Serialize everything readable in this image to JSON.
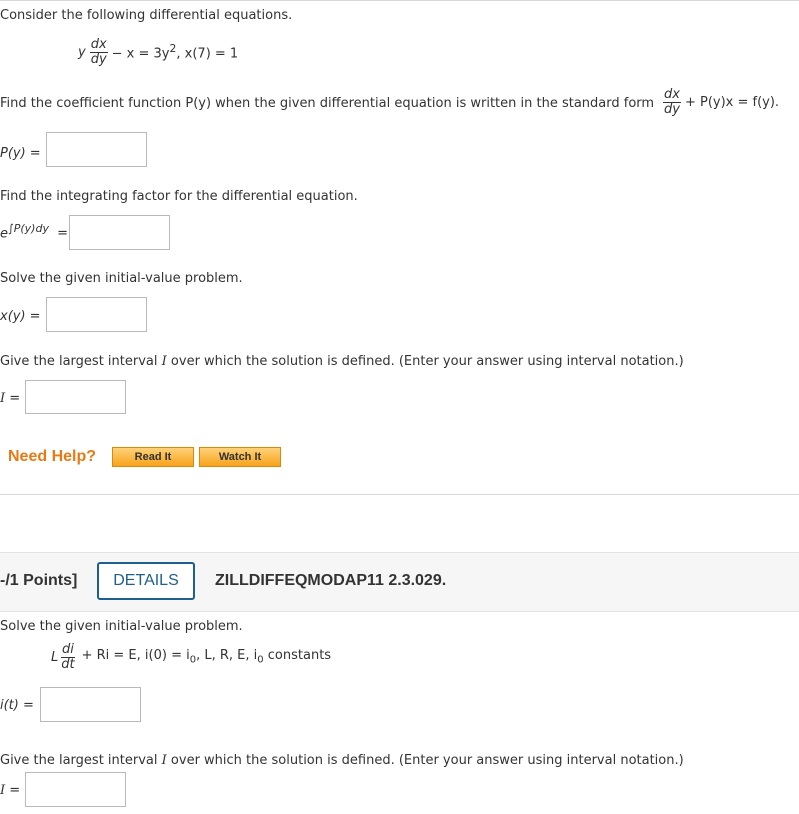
{
  "q1": {
    "intro": "Consider the following differential equations.",
    "eq_y": "y",
    "eq_dx": "dx",
    "eq_dy": "dy",
    "eq_rest": "− x = 3y",
    "eq_exp": "2",
    "eq_ic": ",   x(7) = 1",
    "p_prompt": "Find the coefficient function P(y) when the given differential equation is written in the standard form",
    "p_form_dx": "dx",
    "p_form_dy": "dy",
    "p_form_rest": "+ P(y)x = f(y).",
    "p_label": "P(y) =",
    "if_prompt": "Find the integrating factor for the differential equation.",
    "if_base": "e",
    "if_exp": "∫P(y)dy",
    "if_eq": "=",
    "solve_prompt": "Solve the given initial-value problem.",
    "x_label": "x(y) =",
    "interval_prompt_a": "Give the largest interval",
    "interval_I": "I",
    "interval_prompt_b": "over which the solution is defined. (Enter your answer using interval notation.)",
    "interval_label_I": "I",
    "interval_label_eq": "=",
    "need_help": "Need Help?",
    "read_it": "Read It",
    "watch_it": "Watch It"
  },
  "q2": {
    "points": "-/1 Points]",
    "details": "DETAILS",
    "code": "ZILLDIFFEQMODAP11 2.3.029.",
    "solve_prompt": "Solve the given initial-value problem.",
    "eq_L": "L",
    "eq_di": "di",
    "eq_dt": "dt",
    "eq_rest": "+ Ri = E,    i(0) = i",
    "eq_sub0": "0",
    "eq_comma": ",    L, R, E, i",
    "eq_sub0b": "0",
    "eq_constants": " constants",
    "i_label": "i(t) =",
    "interval_prompt_a": "Give the largest interval",
    "interval_I": "I",
    "interval_prompt_b": "over which the solution is defined. (Enter your answer using interval notation.)",
    "interval_label_I": "I",
    "interval_label_eq": "="
  },
  "colors": {
    "need_help": "#e87a14",
    "details_border": "#1f5f8b",
    "details_text": "#1f5f8b"
  }
}
